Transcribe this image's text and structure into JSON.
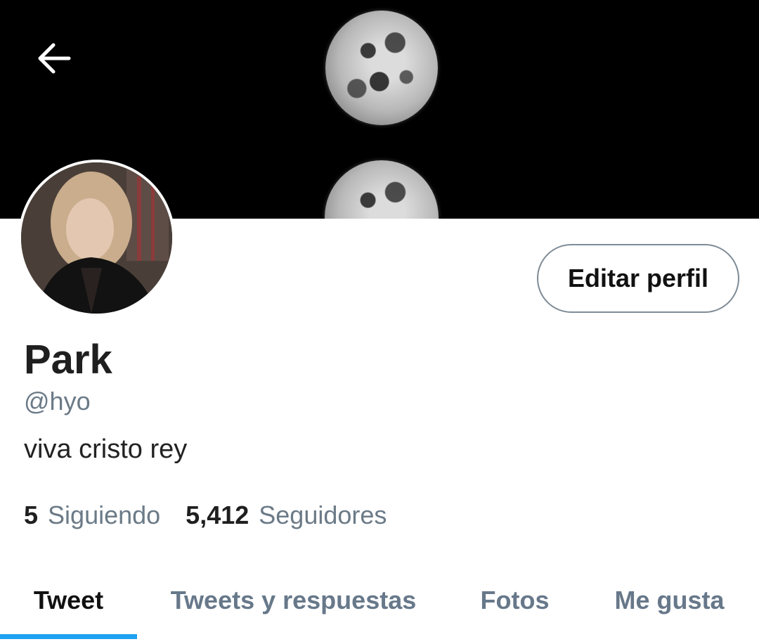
{
  "profile": {
    "display_name": "Park",
    "handle": "@hyo",
    "bio": "viva cristo rey",
    "edit_button_label": "Editar perfil"
  },
  "stats": {
    "following_count": "5",
    "following_label": "Siguiendo",
    "followers_count": "5,412",
    "followers_label": "Seguidores"
  },
  "tabs": [
    {
      "label": "Tweet",
      "active": true
    },
    {
      "label": "Tweets y respuestas",
      "active": false
    },
    {
      "label": "Fotos",
      "active": false
    },
    {
      "label": "Me gusta",
      "active": false
    }
  ],
  "icons": {
    "back": "arrow-left-icon"
  },
  "colors": {
    "accent": "#1da1f2",
    "banner_background": "#000000",
    "muted_text": "#6b7a87",
    "button_border": "#7e8b96"
  }
}
